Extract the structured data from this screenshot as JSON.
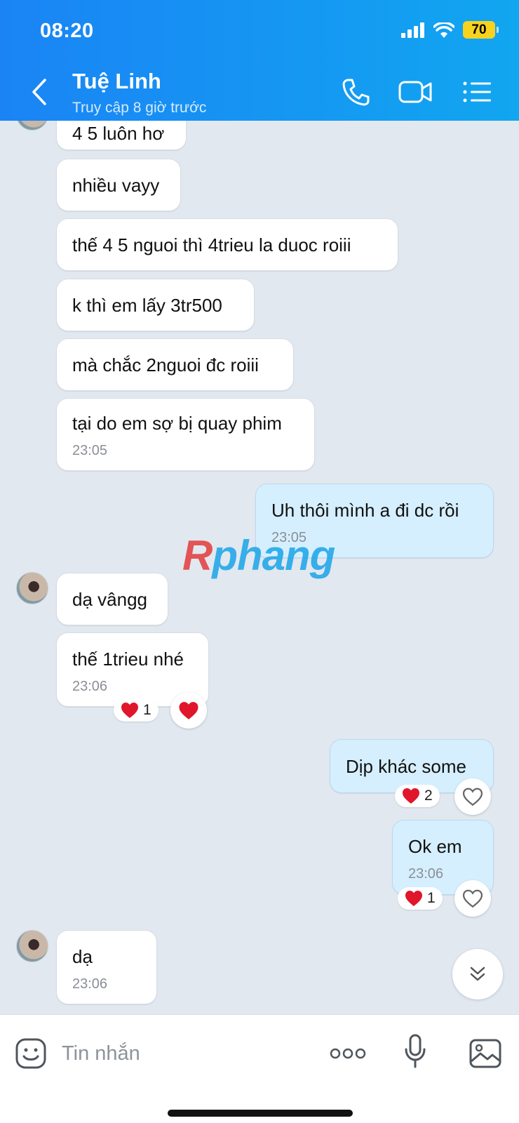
{
  "status_bar": {
    "time": "08:20",
    "battery": "70"
  },
  "header": {
    "contact_name": "Tuệ Linh",
    "contact_status": "Truy cập 8 giờ trước",
    "icons": [
      "back-icon",
      "phone-icon",
      "video-call-icon",
      "menu-list-icon"
    ]
  },
  "messages": [
    {
      "dir": "in",
      "text": "4 5 luôn hơ"
    },
    {
      "dir": "in",
      "text": "nhiều vayy"
    },
    {
      "dir": "in",
      "text": "thế 4 5 nguoi thì 4trieu la duoc roiii"
    },
    {
      "dir": "in",
      "text": "k thì em lấy 3tr500"
    },
    {
      "dir": "in",
      "text": "mà chắc 2nguoi đc roiii"
    },
    {
      "dir": "in",
      "text": "tại do em sợ bị quay phim",
      "time": "23:05"
    },
    {
      "dir": "out",
      "text": "Uh thôi mình a đi dc rồi",
      "time": "23:05"
    },
    {
      "dir": "in",
      "text": "dạ vângg"
    },
    {
      "dir": "in",
      "text": "thế 1trieu nhé",
      "time": "23:06",
      "reaction_count": "1"
    },
    {
      "dir": "out",
      "text": "Dịp khác some",
      "reaction_count": "2"
    },
    {
      "dir": "out",
      "text": "Ok em",
      "time": "23:06",
      "reaction_count": "1"
    },
    {
      "dir": "in",
      "text": "dạ",
      "time": "23:06"
    }
  ],
  "watermark": {
    "first": "R",
    "rest": "phang"
  },
  "input": {
    "placeholder": "Tin nhắn"
  },
  "colors": {
    "header_start": "#1a84f5",
    "header_end": "#11a6f0",
    "outgoing_bubble": "#d5efff",
    "chat_bg": "#e2e8f0",
    "heart": "#e0162b"
  }
}
